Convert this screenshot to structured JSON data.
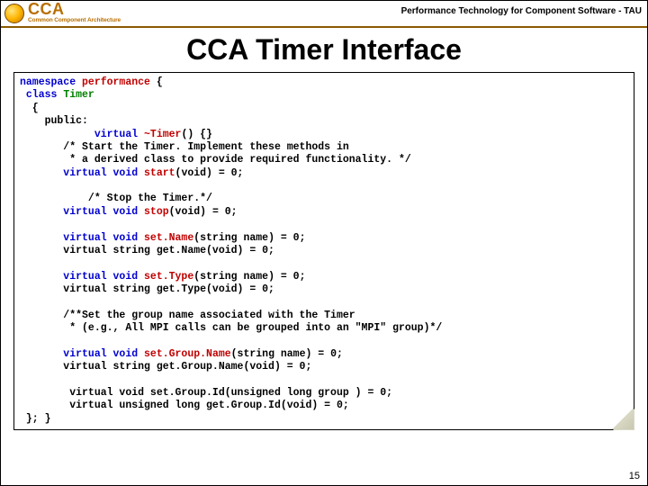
{
  "header": {
    "logo_text": "CCA",
    "logo_sub": "Common Component Architecture",
    "tagline": "Performance Technology for Component Software - TAU"
  },
  "title": "CCA Timer Interface",
  "code": {
    "l1_a": "namespace",
    "l1_b": " performance",
    "l1_c": " {",
    "l2_a": " class",
    "l2_b": " Timer",
    "l3": "  {",
    "l4": "    public:",
    "l5_a": "            virtual",
    "l5_b": " ~Timer",
    "l5_c": "() {}",
    "l6": "       /* Start the Timer. Implement these methods in",
    "l7": "        * a derived class to provide required functionality. */",
    "l8_a": "       virtual void",
    "l8_b": " start",
    "l8_c": "(void) = 0;",
    "blk1": "",
    "l9": "           /* Stop the Timer.*/",
    "l10_a": "       virtual void",
    "l10_b": " stop",
    "l10_c": "(void) = 0;",
    "blk2": "",
    "l11_a": "       virtual void",
    "l11_b": " set.Name",
    "l11_c": "(string name) = 0;",
    "l12": "       virtual string get.Name(void) = 0;",
    "blk3": "",
    "l13_a": "       virtual void",
    "l13_b": " set.Type",
    "l13_c": "(string name) = 0;",
    "l14": "       virtual string get.Type(void) = 0;",
    "blk4": "",
    "l15": "       /**Set the group name associated with the Timer",
    "l16": "        * (e.g., All MPI calls can be grouped into an \"MPI\" group)*/",
    "blk5": "",
    "l17_a": "       virtual void",
    "l17_b": " set.Group.Name",
    "l17_c": "(string name) = 0;",
    "l18": "       virtual string get.Group.Name(void) = 0;",
    "blk6": "",
    "l19": "        virtual void set.Group.Id(unsigned long group ) = 0;",
    "l20": "        virtual unsigned long get.Group.Id(void) = 0;",
    "l21": " }; }"
  },
  "page_number": "15"
}
